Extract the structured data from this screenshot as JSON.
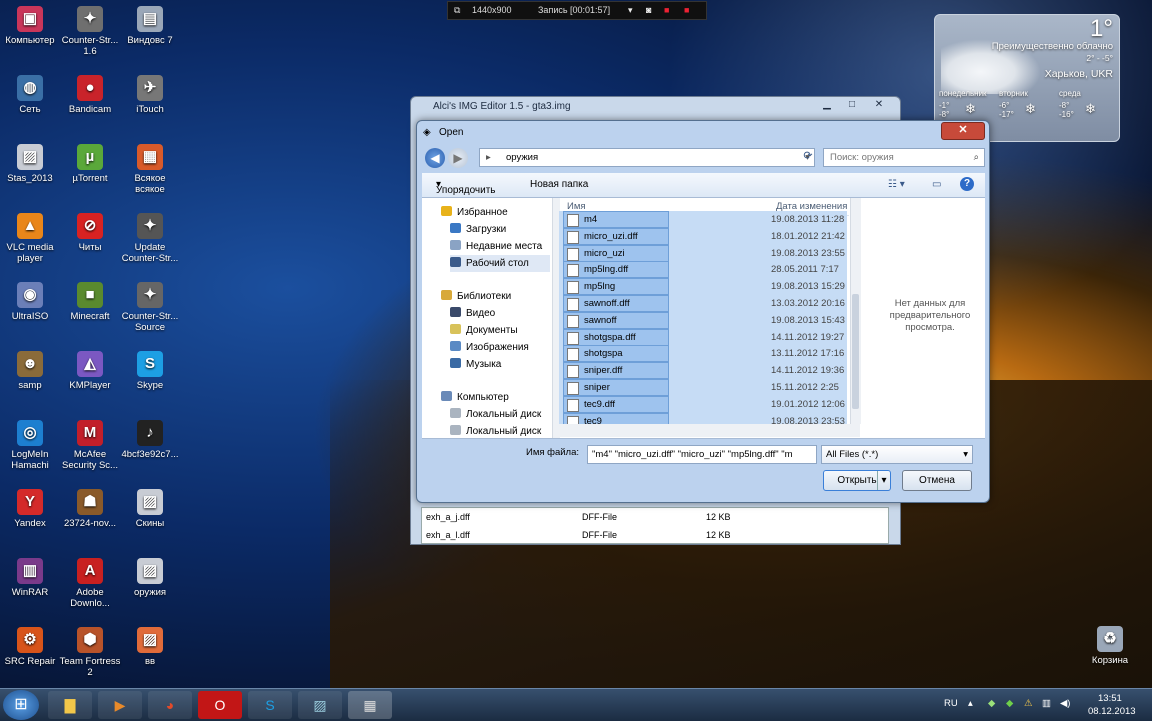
{
  "desktop_icons": [
    {
      "label": "Компьютер",
      "glyph": "▣",
      "color": "#c9365a"
    },
    {
      "label": "Counter-Str... 1.6",
      "glyph": "✦",
      "color": "#6f6f6f"
    },
    {
      "label": "Виндовс 7",
      "glyph": "▤",
      "color": "#9aa7b8"
    },
    {
      "label": "Сеть",
      "glyph": "◍",
      "color": "#3a6fa6"
    },
    {
      "label": "Bandicam",
      "glyph": "●",
      "color": "#c9232a"
    },
    {
      "label": "iTouch",
      "glyph": "✈",
      "color": "#777"
    },
    {
      "label": "Stas_2013",
      "glyph": "▨",
      "color": "#c8ccd4"
    },
    {
      "label": "µTorrent",
      "glyph": "µ",
      "color": "#5aa83a"
    },
    {
      "label": "Всякое всякое",
      "glyph": "▦",
      "color": "#d85a2a"
    },
    {
      "label": "VLC media player",
      "glyph": "▲",
      "color": "#e9861a"
    },
    {
      "label": "Читы",
      "glyph": "⊘",
      "color": "#d82222"
    },
    {
      "label": "Update Counter-Str...",
      "glyph": "✦",
      "color": "#555"
    },
    {
      "label": "UltraISO",
      "glyph": "◉",
      "color": "#6b7fb8"
    },
    {
      "label": "Minecraft",
      "glyph": "■",
      "color": "#5a8a2e"
    },
    {
      "label": "Counter-Str... Source",
      "glyph": "✦",
      "color": "#666"
    },
    {
      "label": "samp",
      "glyph": "☻",
      "color": "#8a6b3a"
    },
    {
      "label": "KMPlayer",
      "glyph": "◭",
      "color": "#7b58c2"
    },
    {
      "label": "Skype",
      "glyph": "S",
      "color": "#1d9fe4"
    },
    {
      "label": "LogMeIn Hamachi",
      "glyph": "◎",
      "color": "#1d7fd0"
    },
    {
      "label": "McAfee Security Sc...",
      "glyph": "M",
      "color": "#c21f2a"
    },
    {
      "label": "4bcf3e92c7...",
      "glyph": "♪",
      "color": "#222"
    },
    {
      "label": "Yandex",
      "glyph": "Y",
      "color": "#d42a2a"
    },
    {
      "label": "23724-nov...",
      "glyph": "☗",
      "color": "#8a5a2a"
    },
    {
      "label": "Скины",
      "glyph": "▨",
      "color": "#c8ccd4"
    },
    {
      "label": "WinRAR",
      "glyph": "▥",
      "color": "#7a3a8a"
    },
    {
      "label": "Adobe Downlo...",
      "glyph": "A",
      "color": "#c82020"
    },
    {
      "label": "оружия",
      "glyph": "▨",
      "color": "#c8ccd4"
    },
    {
      "label": "SRC Repair",
      "glyph": "⚙",
      "color": "#d8541a"
    },
    {
      "label": "Team Fortress 2",
      "glyph": "⬢",
      "color": "#b8532a"
    },
    {
      "label": "вв",
      "glyph": "▨",
      "color": "#e06b3a"
    },
    {
      "label": "Корзина",
      "glyph": "♻",
      "color": "#9aa7b8"
    }
  ],
  "recorder": {
    "resolution": "1440x900",
    "status": "Запись [00:01:57]"
  },
  "weather": {
    "temp": "1°",
    "condition": "Преимущественно облачно",
    "range": "2° - -5°",
    "city": "Харьков, UKR",
    "days": [
      {
        "name": "понедельник",
        "hi": "-1°",
        "lo": "-8°"
      },
      {
        "name": "вторник",
        "hi": "-6°",
        "lo": "-17°"
      },
      {
        "name": "среда",
        "hi": "-8°",
        "lo": "-16°"
      }
    ]
  },
  "back_window": {
    "title": "Alci's IMG Editor 1.5 - gta3.img",
    "rows": [
      {
        "name": "exh_a_j.dff",
        "type": "DFF-File",
        "size": "12 KB"
      },
      {
        "name": "exh_a_l.dff",
        "type": "DFF-File",
        "size": "12 KB"
      }
    ]
  },
  "dialog": {
    "title": "Open",
    "address": "оружия",
    "search_placeholder": "Поиск: оружия",
    "organize": "Упорядочить",
    "new_folder": "Новая папка",
    "tree": [
      {
        "label": "Избранное",
        "indent": 0,
        "color": "#e8b21a"
      },
      {
        "label": "Загрузки",
        "indent": 1,
        "color": "#3a78c4"
      },
      {
        "label": "Недавние места",
        "indent": 1,
        "color": "#8aa3c4"
      },
      {
        "label": "Рабочий стол",
        "indent": 1,
        "color": "#3a5a8a"
      },
      {
        "label": "Библиотеки",
        "indent": 0,
        "color": "#d8a93a"
      },
      {
        "label": "Видео",
        "indent": 1,
        "color": "#3a4a6a"
      },
      {
        "label": "Документы",
        "indent": 1,
        "color": "#d8c25a"
      },
      {
        "label": "Изображения",
        "indent": 1,
        "color": "#5a8ac4"
      },
      {
        "label": "Музыка",
        "indent": 1,
        "color": "#3a6aa4"
      },
      {
        "label": "Компьютер",
        "indent": 0,
        "color": "#6a8ab8"
      },
      {
        "label": "Локальный диск",
        "indent": 1,
        "color": "#aab4c0"
      },
      {
        "label": "Локальный диск",
        "indent": 1,
        "color": "#aab4c0"
      }
    ],
    "columns": {
      "name": "Имя",
      "date": "Дата изменения"
    },
    "files": [
      {
        "name": "m4",
        "date": "19.08.2013 11:28"
      },
      {
        "name": "micro_uzi.dff",
        "date": "18.01.2012 21:42"
      },
      {
        "name": "micro_uzi",
        "date": "19.08.2013 23:55"
      },
      {
        "name": "mp5lng.dff",
        "date": "28.05.2011 7:17"
      },
      {
        "name": "mp5lng",
        "date": "19.08.2013 15:29"
      },
      {
        "name": "sawnoff.dff",
        "date": "13.03.2012 20:16"
      },
      {
        "name": "sawnoff",
        "date": "19.08.2013 15:43"
      },
      {
        "name": "shotgspa.dff",
        "date": "14.11.2012 19:27"
      },
      {
        "name": "shotgspa",
        "date": "13.11.2012 17:16"
      },
      {
        "name": "sniper.dff",
        "date": "14.11.2012 19:36"
      },
      {
        "name": "sniper",
        "date": "15.11.2012 2:25"
      },
      {
        "name": "tec9.dff",
        "date": "19.01.2012 12:06"
      },
      {
        "name": "tec9",
        "date": "19.08.2013 23:53"
      }
    ],
    "preview_text": "Нет данных для предварительного просмотра.",
    "filename_label": "Имя файла:",
    "filename_value": "\"m4\" \"micro_uzi.dff\" \"micro_uzi\" \"mp5lng.dff\" \"m",
    "filetype": "All Files (*.*)",
    "open": "Открыть",
    "cancel": "Отмена"
  },
  "taskbar": {
    "lang": "RU",
    "time": "13:51",
    "date": "08.12.2013"
  }
}
